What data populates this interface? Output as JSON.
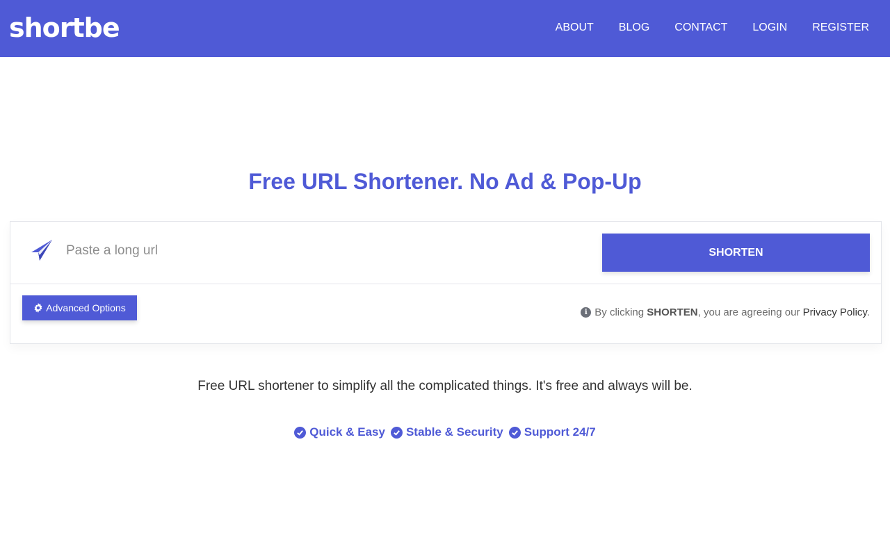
{
  "brand": {
    "logo": "shortbe",
    "accent_color": "#4f5ad6"
  },
  "nav": {
    "items": [
      {
        "label": "ABOUT"
      },
      {
        "label": "BLOG"
      },
      {
        "label": "CONTACT"
      },
      {
        "label": "LOGIN"
      },
      {
        "label": "REGISTER"
      }
    ]
  },
  "hero": {
    "title": "Free URL Shortener. No Ad & Pop-Up"
  },
  "shortener": {
    "input_placeholder": "Paste a long url",
    "input_value": "",
    "submit_label": "SHORTEN",
    "advanced_label": "Advanced Options",
    "policy_prefix": "By clicking",
    "policy_strong": "SHORTEN",
    "policy_middle": ", you are agreeing our",
    "policy_link": "Privacy Policy",
    "policy_suffix": "."
  },
  "tagline": "Free URL shortener to simplify all the complicated things. It's free and always will be.",
  "features": [
    {
      "label": "Quick & Easy",
      "icon": "check-circle-icon"
    },
    {
      "label": "Stable & Security",
      "icon": "check-circle-icon"
    },
    {
      "label": "Support 24/7",
      "icon": "check-circle-icon"
    }
  ]
}
